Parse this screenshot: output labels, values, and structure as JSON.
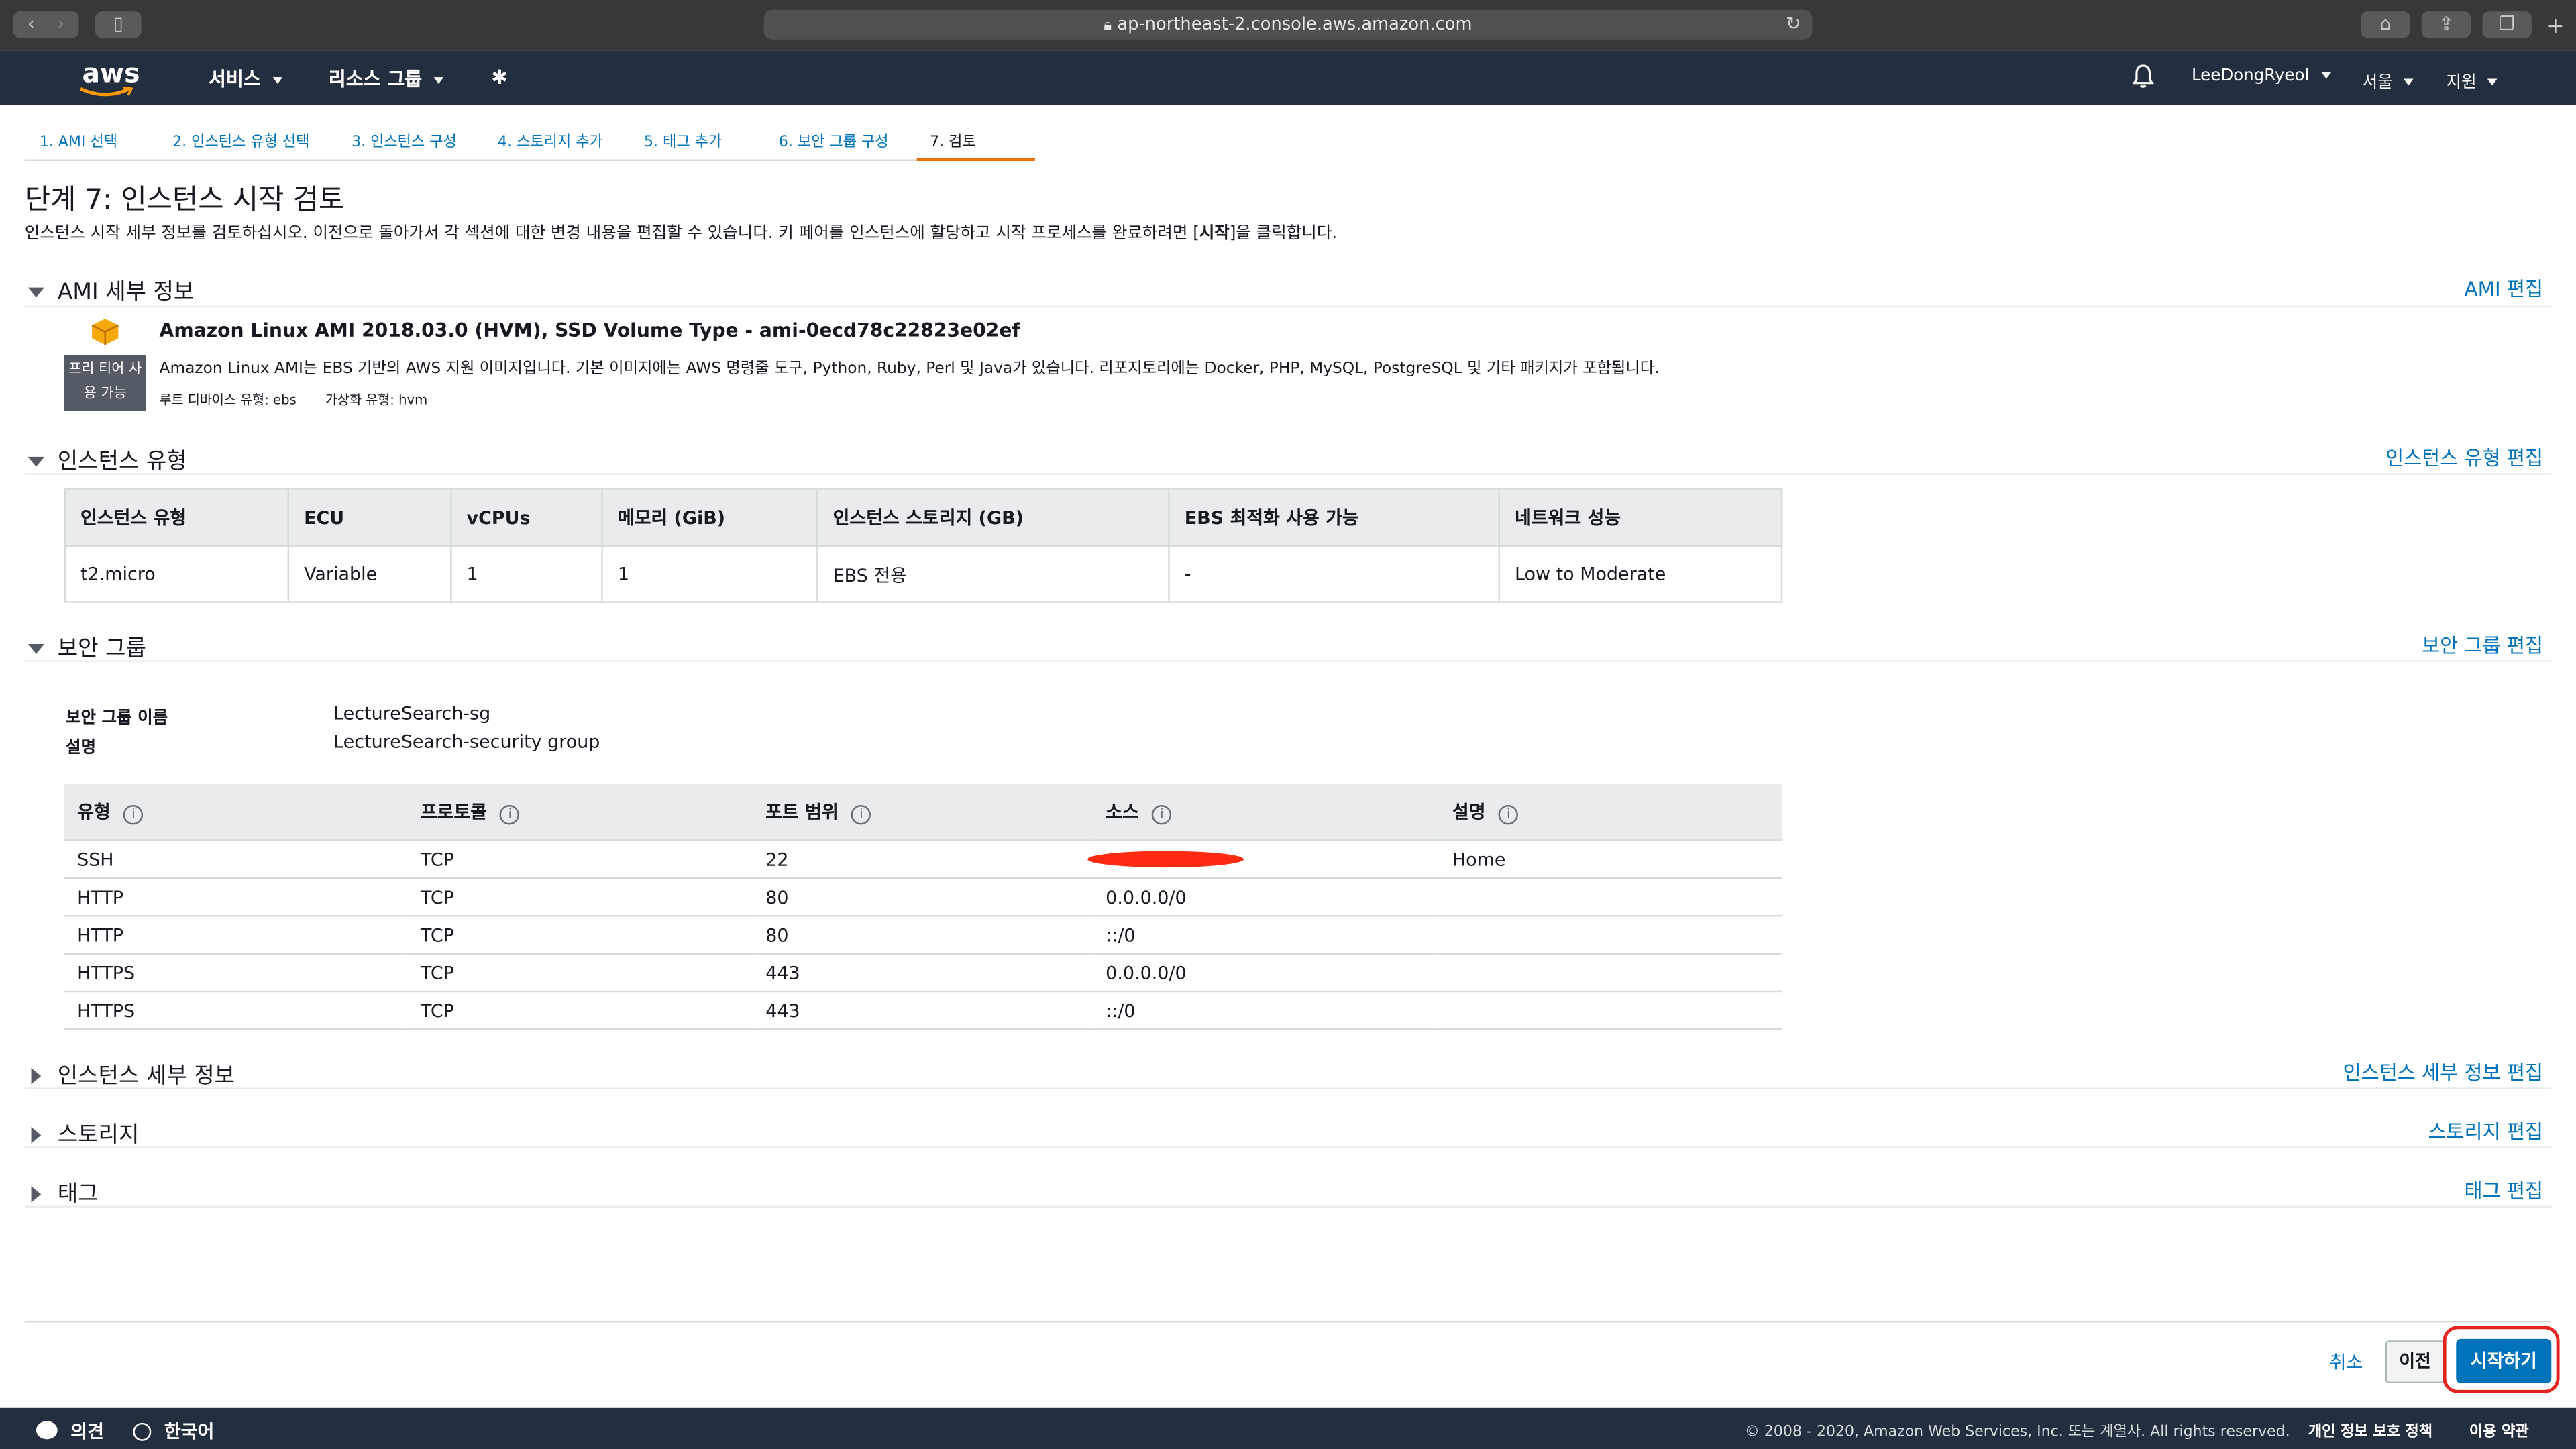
{
  "browser": {
    "url": "ap-northeast-2.console.aws.amazon.com"
  },
  "nav": {
    "logo": "aws",
    "services": "서비스",
    "resource_groups": "리소스 그룹",
    "user": "LeeDongRyeol",
    "region": "서울",
    "support": "지원"
  },
  "wizard": {
    "tabs": [
      {
        "label": "1. AMI 선택"
      },
      {
        "label": "2. 인스턴스 유형 선택"
      },
      {
        "label": "3. 인스턴스 구성"
      },
      {
        "label": "4. 스토리지 추가"
      },
      {
        "label": "5. 태그 추가"
      },
      {
        "label": "6. 보안 그룹 구성"
      },
      {
        "label": "7. 검토"
      }
    ],
    "active_tab": "7. 검토"
  },
  "page": {
    "title": "단계 7: 인스턴스 시작 검토",
    "desc_before": "인스턴스 시작 세부 정보를 검토하십시오. 이전으로 돌아가서 각 섹션에 대한 변경 내용을 편집할 수 있습니다. 키 페어를 인스턴스에 할당하고 시작 프로세스를 완료하려면 [",
    "desc_bold": "시작",
    "desc_after": "]을 클릭합니다."
  },
  "ami": {
    "section_title": "AMI 세부 정보",
    "edit": "AMI 편집",
    "name": "Amazon Linux AMI 2018.03.0 (HVM), SSD Volume Type - ami-0ecd78c22823e02ef",
    "badge": "프리 티어 사용 가능",
    "description": "Amazon Linux AMI는 EBS 기반의 AWS 지원 이미지입니다. 기본 이미지에는 AWS 명령줄 도구, Python, Ruby, Perl 및 Java가 있습니다. 리포지토리에는 Docker, PHP, MySQL, PostgreSQL 및 기타 패키지가 포함됩니다.",
    "root_device": "루트 디바이스 유형: ebs",
    "virtualization": "가상화 유형: hvm"
  },
  "instance_type": {
    "section_title": "인스턴스 유형",
    "edit": "인스턴스 유형 편집",
    "headers": [
      "인스턴스 유형",
      "ECU",
      "vCPUs",
      "메모리 (GiB)",
      "인스턴스 스토리지 (GB)",
      "EBS 최적화 사용 가능",
      "네트워크 성능"
    ],
    "row": [
      "t2.micro",
      "Variable",
      "1",
      "1",
      "EBS 전용",
      "-",
      "Low to Moderate"
    ]
  },
  "security_group": {
    "section_title": "보안 그룹",
    "edit": "보안 그룹 편집",
    "name_label": "보안 그룹 이름",
    "name_value": "LectureSearch-sg",
    "desc_label": "설명",
    "desc_value": "LectureSearch-security group",
    "headers": [
      "유형",
      "프로토콜",
      "포트 범위",
      "소스",
      "설명"
    ],
    "rules": [
      {
        "type": "SSH",
        "protocol": "TCP",
        "port": "22",
        "source": "",
        "description": "Home"
      },
      {
        "type": "HTTP",
        "protocol": "TCP",
        "port": "80",
        "source": "0.0.0.0/0",
        "description": ""
      },
      {
        "type": "HTTP",
        "protocol": "TCP",
        "port": "80",
        "source": "::/0",
        "description": ""
      },
      {
        "type": "HTTPS",
        "protocol": "TCP",
        "port": "443",
        "source": "0.0.0.0/0",
        "description": ""
      },
      {
        "type": "HTTPS",
        "protocol": "TCP",
        "port": "443",
        "source": "::/0",
        "description": ""
      }
    ]
  },
  "collapsed": [
    {
      "title": "인스턴스 세부 정보",
      "edit": "인스턴스 세부 정보 편집"
    },
    {
      "title": "스토리지",
      "edit": "스토리지 편집"
    },
    {
      "title": "태그",
      "edit": "태그 편집"
    }
  ],
  "actions": {
    "cancel": "취소",
    "previous": "이전",
    "launch": "시작하기"
  },
  "footer": {
    "feedback": "의견",
    "language": "한국어",
    "copyright": "© 2008 - 2020, Amazon Web Services, Inc. 또는 계열사. All rights reserved.",
    "privacy": "개인 정보 보호 정책",
    "terms": "이용 약관"
  },
  "colors": {
    "nav_bg": "#232f3e",
    "link": "#0073bb",
    "active_tab": "#ec7211",
    "primary_button": "#0073bb",
    "annotation_circle": "#e5231f",
    "redaction": "#ff2a12"
  }
}
